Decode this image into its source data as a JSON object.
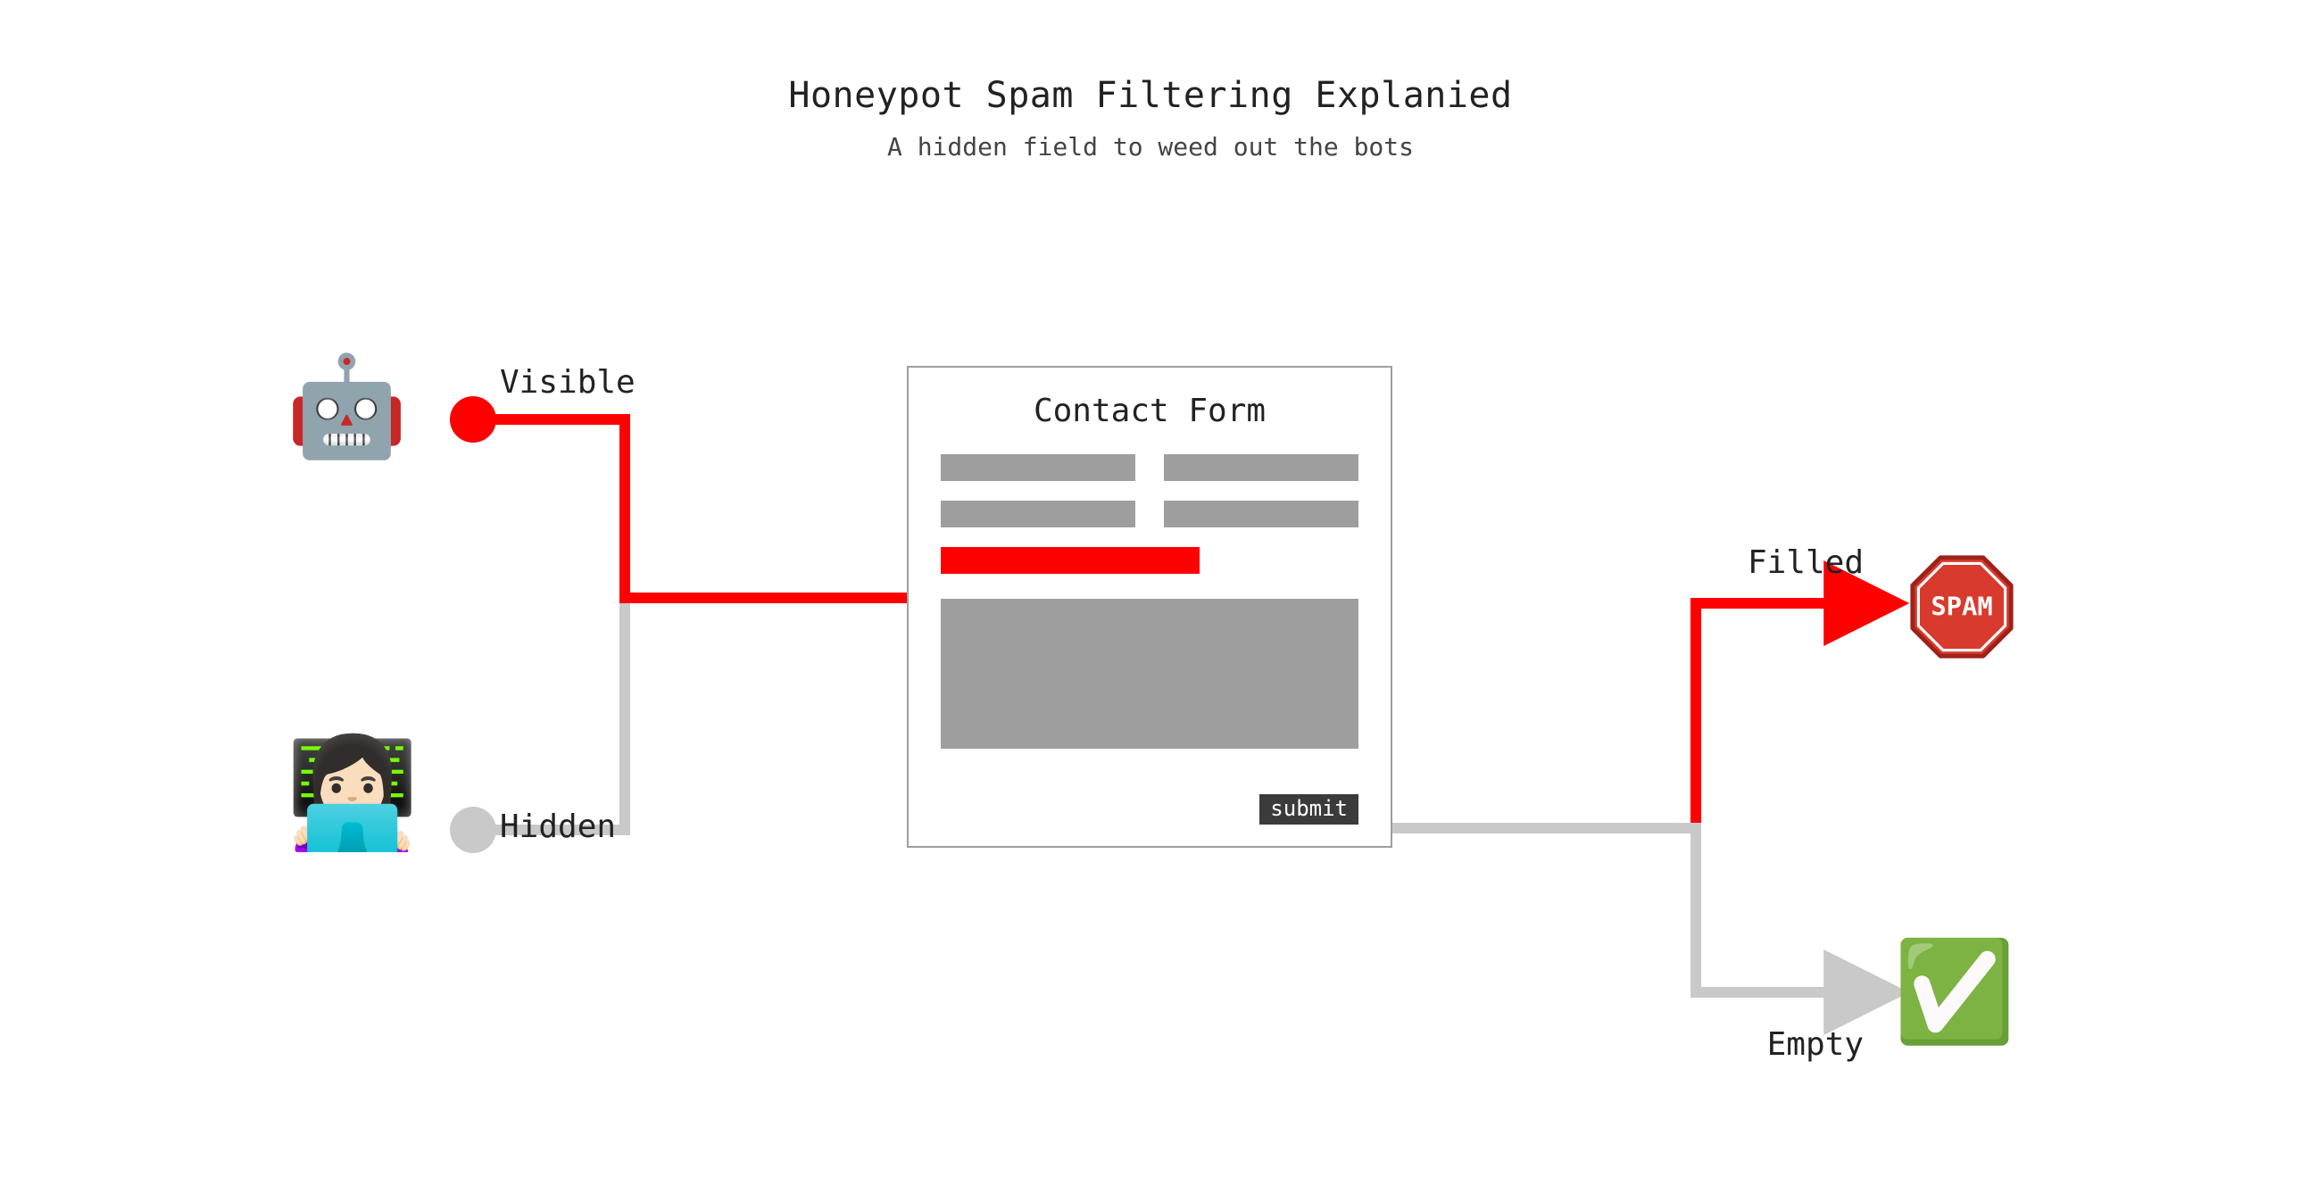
{
  "title": "Honeypot Spam Filtering Explanied",
  "subtitle": "A hidden field to weed out the bots",
  "labels": {
    "visible": "Visible",
    "hidden": "Hidden",
    "filled": "Filled",
    "empty": "Empty"
  },
  "form": {
    "heading": "Contact Form",
    "submit": "submit"
  },
  "icons": {
    "robot": "🤖",
    "human": "👩🏻‍💻",
    "spam_text": "SPAM",
    "check": "✅"
  },
  "colors": {
    "bot_path": "#ff0000",
    "human_path": "#c9c9c9",
    "field_grey": "#9e9e9e",
    "submit_bg": "#3b3b3b",
    "spam_fill": "#d83a2d",
    "spam_stroke": "#9e221a"
  }
}
